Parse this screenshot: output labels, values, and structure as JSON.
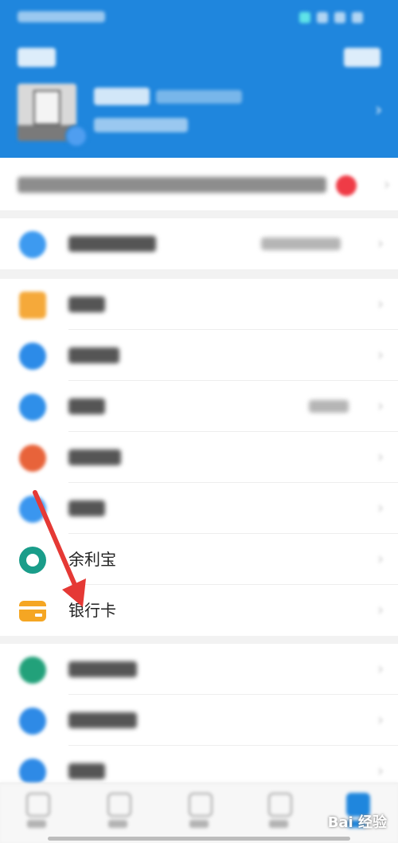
{
  "rows": {
    "yulibao_label": "余利宝",
    "bankcard_label": "银行卡"
  },
  "watermark": "Bai 经验",
  "colors": {
    "header_bg": "#1f86dd",
    "accent_red": "#ef3b46",
    "annotation_arrow": "#e53935"
  },
  "icons": {
    "header_chevron": "chevron-right-icon",
    "row_chevron": "chevron-right-icon",
    "notice_dot": "red-notice-dot-icon",
    "bankcard": "bank-card-icon",
    "yulibao": "yulibao-icon"
  }
}
